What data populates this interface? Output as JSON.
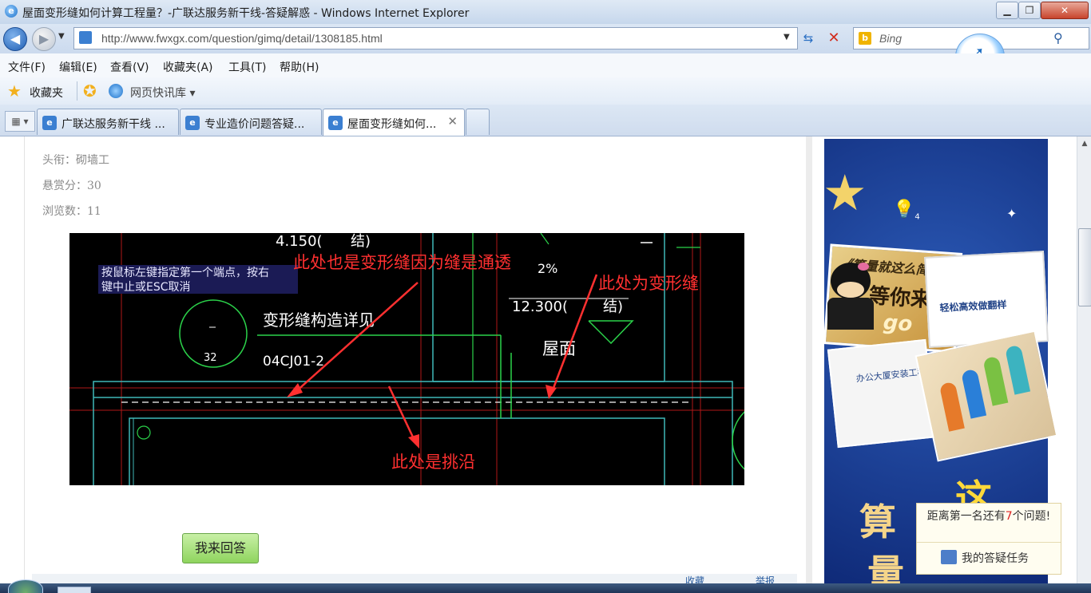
{
  "window": {
    "title": "屋面变形缝如何计算工程量？-广联达服务新干线-答疑解惑 - Windows Internet Explorer",
    "min": "▁",
    "max": "❐",
    "close": "✕"
  },
  "address": {
    "url": "http://www.fwxgx.com/question/gimq/detail/1308185.html",
    "search_placeholder": "Bing",
    "back": "◀",
    "forward": "▶"
  },
  "menu": [
    "文件(F)",
    "编辑(E)",
    "查看(V)",
    "收藏夹(A)",
    "工具(T)",
    "帮助(H)"
  ],
  "favorites": {
    "label": "收藏夹",
    "web_slice": "网页快讯库 ▾"
  },
  "tabs": [
    {
      "label": "广联达服务新干线 ...",
      "active": false
    },
    {
      "label": "专业造价问题答疑...",
      "active": false
    },
    {
      "label": "屋面变形缝如何...",
      "active": true
    }
  ],
  "question_info": {
    "title_label": "头衔：砌墙工",
    "reward_label": "悬赏分：30",
    "views_label": "浏览数：11"
  },
  "cad_image": {
    "prompt_line1": "按鼠标左键指定第一个端点，按右",
    "prompt_line2": "键中止或ESC取消",
    "elev1": "4.150(",
    "elev1_suffix": "结)",
    "elev2": "12.300(",
    "elev2_suffix": "结)",
    "percent": "2%",
    "detail_note": "变形缝构造详见",
    "detail_code": "04CJ01-2",
    "bubble_number": "32",
    "roof_label": "屋面",
    "annot1": "此处也是变形缝因为缝是通透",
    "annot2": "此处为变形缝",
    "annot3": "此处是挑沿"
  },
  "answer_button": "我来回答",
  "footer_links": [
    "收藏",
    "举报"
  ],
  "ad": {
    "book_title": "《算量就这么简单》",
    "book_sub": "等你来",
    "book_go": "go",
    "book2_title": "轻松高效做翻样",
    "book3_title": "办公大厦安装工程",
    "bulb_count": "4",
    "big_chars": [
      "算",
      "量",
      "这"
    ]
  },
  "task_panel": {
    "rank_text_prefix": "距离第一名还有",
    "rank_num": "7",
    "rank_text_suffix": "个问题!",
    "my_tasks": "我的答疑任务"
  },
  "colors": {
    "cad_bg": "#000000",
    "annotation_red": "#ff3030",
    "cad_green": "#2bd24a",
    "cad_cyan": "#3fb8b8",
    "ad_blue": "#1c3f95"
  }
}
